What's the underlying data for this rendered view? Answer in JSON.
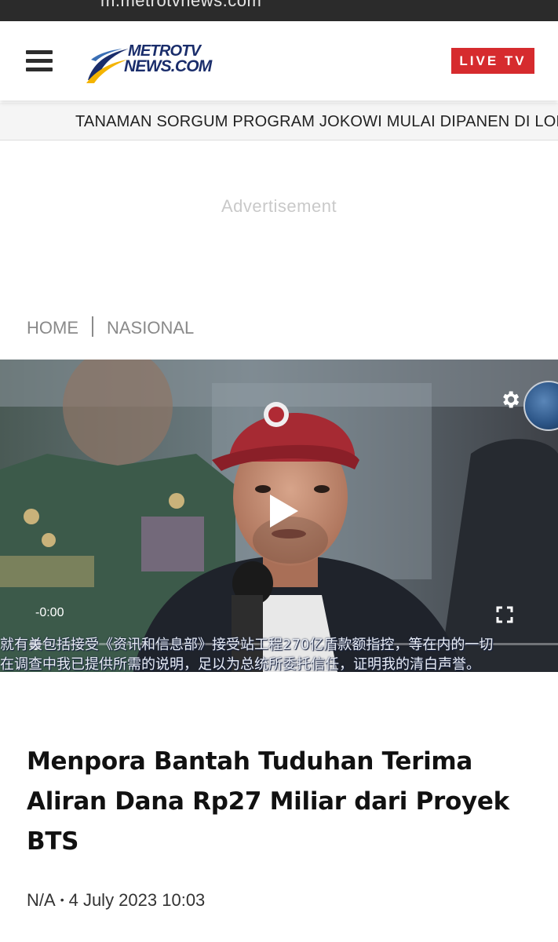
{
  "browser": {
    "url_text": "m.metrotvnews.com"
  },
  "header": {
    "menu_icon": "hamburger-menu-icon",
    "logo": {
      "line1": "METROTV",
      "line2": "NEWS.COM",
      "color": "#1a2d6b",
      "swoosh_colors": [
        "#1a2d6b",
        "#f4b400"
      ]
    },
    "live_button_label": "LIVE TV",
    "live_button_color": "#d62b2e"
  },
  "ticker": {
    "text": "TANAMAN SORGUM PROGRAM JOKOWI MULAI DIPANEN DI LOKASI FOOD ESTATE"
  },
  "ad": {
    "label": "Advertisement"
  },
  "breadcrumb": {
    "items": [
      "HOME",
      "NASIONAL"
    ]
  },
  "video": {
    "time": "-0:00",
    "progress": 0,
    "icons": [
      "play-icon",
      "gear-icon",
      "fullscreen-icon"
    ],
    "subtitle_line1": "就有关包括接受《资讯和信息部》接受站工程270亿盾款额指控，等在内的一切",
    "subtitle_line2": "在调查中我已提供所需的说明，足以为总统所委托信任，证明我的清白声誉。"
  },
  "article": {
    "title": "Menpora Bantah Tuduhan Terima Aliran Dana Rp27 Miliar dari Proyek BTS",
    "author": "N/A",
    "separator": "•",
    "date": "4 July 2023 10:03"
  }
}
